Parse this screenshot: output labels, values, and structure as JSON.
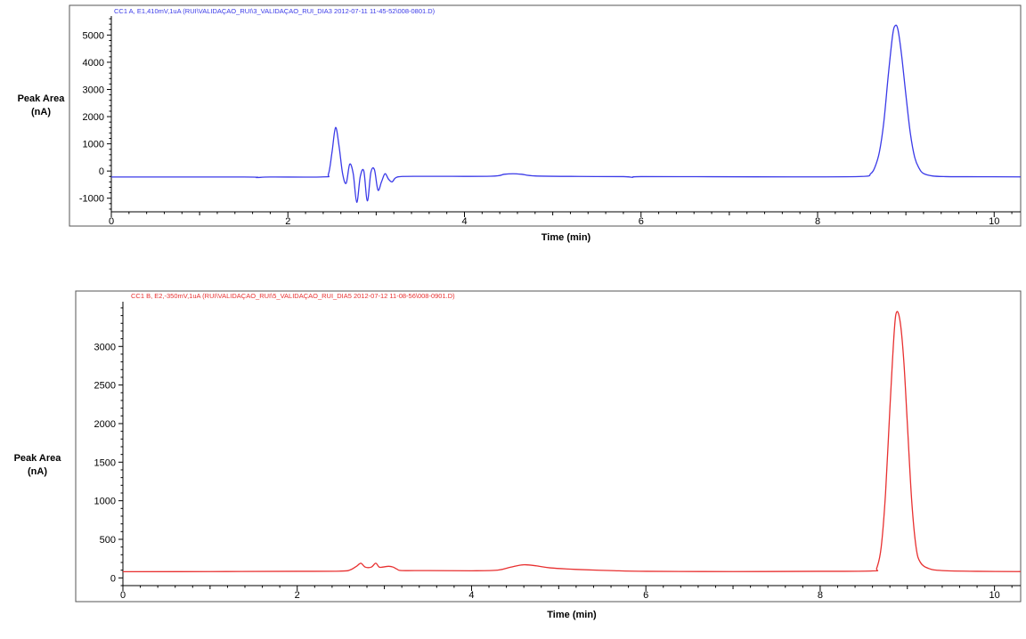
{
  "chart_data": [
    {
      "type": "line",
      "title": "CC1 A, E1,410mV,1uA (RUI\\VALIDAÇAO_RUI\\3_VALIDAÇAO_RUI_DIA3 2012-07-11 11-45-52\\008-0801.D)",
      "xlabel": "Time (min)",
      "ylabel_lines": [
        "Peak Area",
        "(nA)"
      ],
      "xlim": [
        0,
        10.3
      ],
      "ylim": [
        -1500,
        5700
      ],
      "xticks": [
        0,
        2,
        4,
        6,
        8,
        10
      ],
      "yticks": [
        -1000,
        0,
        1000,
        2000,
        3000,
        4000,
        5000
      ],
      "grid": false,
      "color": "#3a3ae8",
      "series": [
        {
          "x": [
            0,
            1.5,
            1.65,
            1.8,
            2.4,
            2.46,
            2.5,
            2.54,
            2.58,
            2.62,
            2.66,
            2.7,
            2.74,
            2.78,
            2.82,
            2.86,
            2.9,
            2.94,
            2.98,
            3.02,
            3.06,
            3.1,
            3.14,
            3.18,
            3.22,
            3.3,
            3.6,
            4.3,
            4.45,
            4.55,
            4.65,
            4.8,
            5.3,
            5.8,
            5.9,
            6.0,
            6.8,
            7.8,
            8.5,
            8.6,
            8.65,
            8.7,
            8.75,
            8.8,
            8.85,
            8.88,
            8.91,
            8.95,
            9.0,
            9.05,
            9.1,
            9.15,
            9.2,
            9.3,
            9.45,
            9.7,
            10.3
          ],
          "y": [
            -220,
            -220,
            -240,
            -220,
            -215,
            -100,
            700,
            1600,
            900,
            -100,
            -450,
            250,
            -100,
            -1150,
            -200,
            0,
            -1100,
            -50,
            50,
            -700,
            -400,
            -100,
            -300,
            -400,
            -250,
            -200,
            -195,
            -190,
            -120,
            -100,
            -120,
            -180,
            -200,
            -205,
            -230,
            -205,
            -210,
            -215,
            -200,
            -100,
            150,
            700,
            1800,
            3500,
            5000,
            5350,
            5200,
            4300,
            2800,
            1400,
            500,
            100,
            -90,
            -180,
            -205,
            -210,
            -215
          ]
        }
      ]
    },
    {
      "type": "line",
      "title": "CC1 B, E2,-350mV,1uA (RUI\\VALIDAÇAO_RUI\\5_VALIDAÇAO_RUI_DIA5 2012-07-12 11-08-56\\008-0901.D)",
      "xlabel": "Time (min)",
      "ylabel_lines": [
        "Peak Area",
        "(nA)"
      ],
      "xlim": [
        0,
        10.3
      ],
      "ylim": [
        -100,
        3580
      ],
      "xticks": [
        0,
        2,
        4,
        6,
        8,
        10
      ],
      "yticks": [
        0,
        500,
        1000,
        1500,
        2000,
        2500,
        3000
      ],
      "grid": false,
      "color": "#e83030",
      "series": [
        {
          "x": [
            0,
            1.0,
            2.0,
            2.5,
            2.6,
            2.68,
            2.73,
            2.78,
            2.85,
            2.9,
            2.94,
            2.98,
            3.05,
            3.1,
            3.15,
            3.2,
            3.5,
            4.0,
            4.3,
            4.45,
            4.6,
            4.75,
            4.9,
            5.2,
            5.6,
            6.0,
            7.0,
            8.0,
            8.6,
            8.65,
            8.7,
            8.75,
            8.8,
            8.85,
            8.88,
            8.92,
            8.96,
            9.0,
            9.05,
            9.1,
            9.15,
            9.25,
            9.4,
            9.8,
            10.3
          ],
          "y": [
            80,
            82,
            85,
            88,
            100,
            150,
            190,
            140,
            140,
            190,
            140,
            140,
            150,
            140,
            110,
            95,
            95,
            92,
            100,
            140,
            170,
            155,
            130,
            110,
            95,
            85,
            82,
            85,
            90,
            130,
            400,
            1100,
            2200,
            3200,
            3450,
            3300,
            2800,
            2000,
            1000,
            400,
            200,
            120,
            95,
            85,
            82
          ]
        }
      ]
    }
  ]
}
